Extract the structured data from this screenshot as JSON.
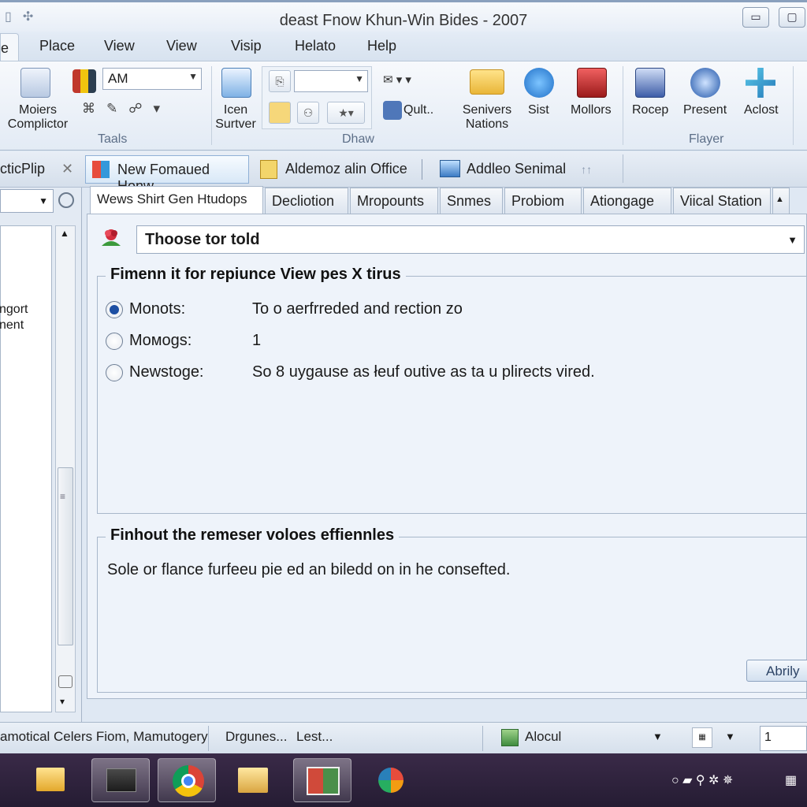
{
  "window": {
    "title": "deast Fnow Khun-Win Bides - 2007",
    "controls": {
      "minimize": "▭",
      "restore": "▢"
    }
  },
  "menu": {
    "tabs": [
      "e",
      "Place",
      "View",
      "View",
      "Visip",
      "Helato",
      "Help"
    ]
  },
  "ribbon": {
    "buttons": {
      "moiers": "Moiers\nComplictor",
      "icen": "Icen\nSurtver",
      "qult": "Qult..",
      "senivers": "Senivers\nNations",
      "sist": "Sist",
      "mollors": "Mollors",
      "rocep": "Rocep",
      "present": "Present",
      "aclost": "Aclost"
    },
    "font_combo_value": "AM",
    "groups": {
      "taals": "Taals",
      "dhaw": "Dhaw",
      "flayer": "Flayer"
    }
  },
  "doc_tabs": {
    "left_pane_title": "cticPlip",
    "close": "✕",
    "tab1": "New Fomaued Honw",
    "tab2": "Aldemoz alin Office",
    "tab3": "Addleo Senimal"
  },
  "left_pane": {
    "list_text": "ngort\nnent"
  },
  "content_tabs": [
    "Wews Shirt Gen Htudops",
    "Decliotion",
    "Mropounts",
    "Snmes",
    "Probiom",
    "Ationgage",
    "Viical Station"
  ],
  "main": {
    "select_value": "Thoose tor told",
    "section1": {
      "legend": "Fimenn it for repiunce View pes X tirus",
      "options": [
        {
          "label": "Monots:",
          "value": "To o aerfrreded and rection zo",
          "checked": true
        },
        {
          "label": "Moмogs:",
          "value": "1",
          "checked": false
        },
        {
          "label": "Newstoge:",
          "value": "So 8 uygause as łeuf outive as ta u plirects vired.",
          "checked": false
        }
      ]
    },
    "section2": {
      "legend": "Finhout the remeser voloes effiennles",
      "description": "Sole or flance furfeeu pie ed an biledd on in he consefted."
    },
    "apply_button": "Abrily"
  },
  "statusbar": {
    "left": "amotical Celers Fiom, Mamutogery",
    "mid1": "Drgunes...",
    "mid2": "Lest...",
    "zoom_label": "Alocul",
    "page": "1"
  },
  "colors": {
    "accent": "#1d4fa3",
    "ribbon_bg": "#e3ebf5",
    "taskbar": "#2b2038"
  }
}
